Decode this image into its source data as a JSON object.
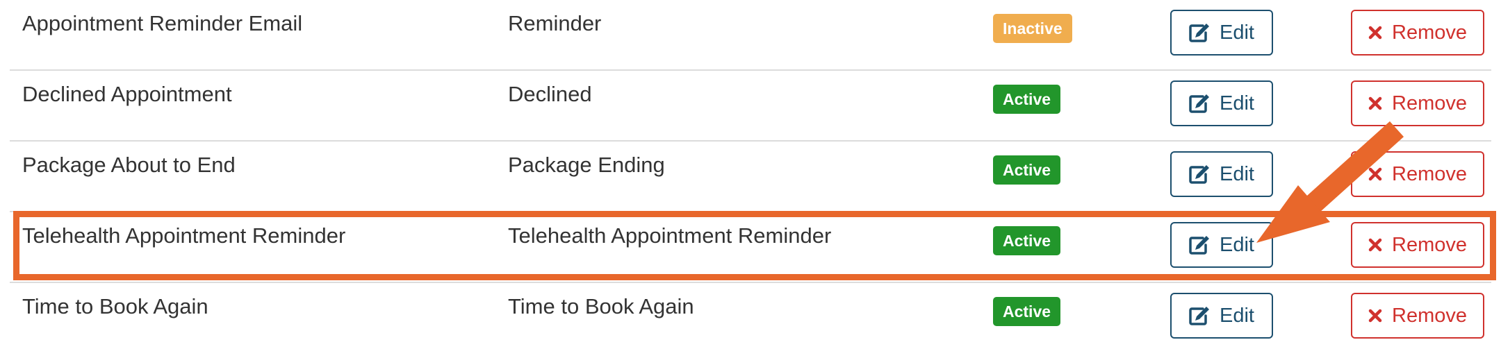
{
  "colors": {
    "active_badge": "#22962b",
    "inactive_badge": "#f0ad4e",
    "edit": "#1c4f6e",
    "remove": "#d0312d",
    "annotation": "#e8672b"
  },
  "buttons": {
    "edit_label": "Edit",
    "remove_label": "Remove"
  },
  "rows": [
    {
      "name": "Appointment Reminder Email",
      "type": "Reminder",
      "status": "Inactive"
    },
    {
      "name": "Declined Appointment",
      "type": "Declined",
      "status": "Active"
    },
    {
      "name": "Package About to End",
      "type": "Package Ending",
      "status": "Active"
    },
    {
      "name": "Telehealth Appointment Reminder",
      "type": "Telehealth Appointment Reminder",
      "status": "Active"
    },
    {
      "name": "Time to Book Again",
      "type": "Time to Book Again",
      "status": "Active"
    }
  ],
  "annotation": {
    "highlighted_row": "Telehealth Appointment Reminder",
    "arrow_target": "edit-button"
  }
}
